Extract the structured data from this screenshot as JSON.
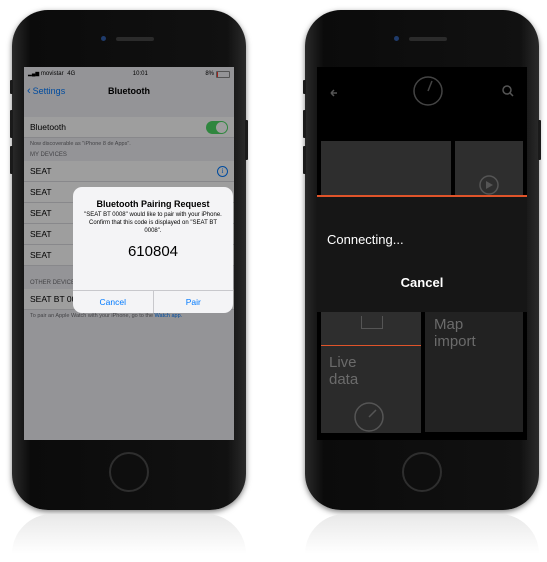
{
  "left_phone": {
    "status": {
      "carrier": "movistar",
      "network": "4G",
      "time": "10:01",
      "battery": "8%"
    },
    "nav": {
      "back_label": "Settings",
      "title": "Bluetooth"
    },
    "bluetooth_row": {
      "label": "Bluetooth",
      "toggle_on": true
    },
    "discoverable_note": "Now discoverable as \"iPhone 8 de Apps\".",
    "my_devices_header": "MY DEVICES",
    "my_devices": [
      {
        "label": "SEAT"
      },
      {
        "label": "SEAT"
      },
      {
        "label": "SEAT"
      },
      {
        "label": "SEAT"
      },
      {
        "label": "SEAT"
      }
    ],
    "other_devices_header": "OTHER DEVICES",
    "other_device": "SEAT BT 0008",
    "watch_note_prefix": "To pair an Apple Watch with your iPhone, go to the",
    "watch_note_link": "Watch app.",
    "alert": {
      "title": "Bluetooth Pairing Request",
      "message": "\"SEAT BT 0008\" would like to pair with your iPhone. Confirm that this code is displayed on \"SEAT BT 0008\".",
      "code": "610804",
      "cancel_label": "Cancel",
      "pair_label": "Pair"
    }
  },
  "right_phone": {
    "tiles": {
      "map_import": "Map\nimport",
      "live_data": "Live\ndata"
    },
    "modal": {
      "text": "Connecting...",
      "cancel_label": "Cancel"
    },
    "colors": {
      "accent": "#e0542a"
    }
  }
}
